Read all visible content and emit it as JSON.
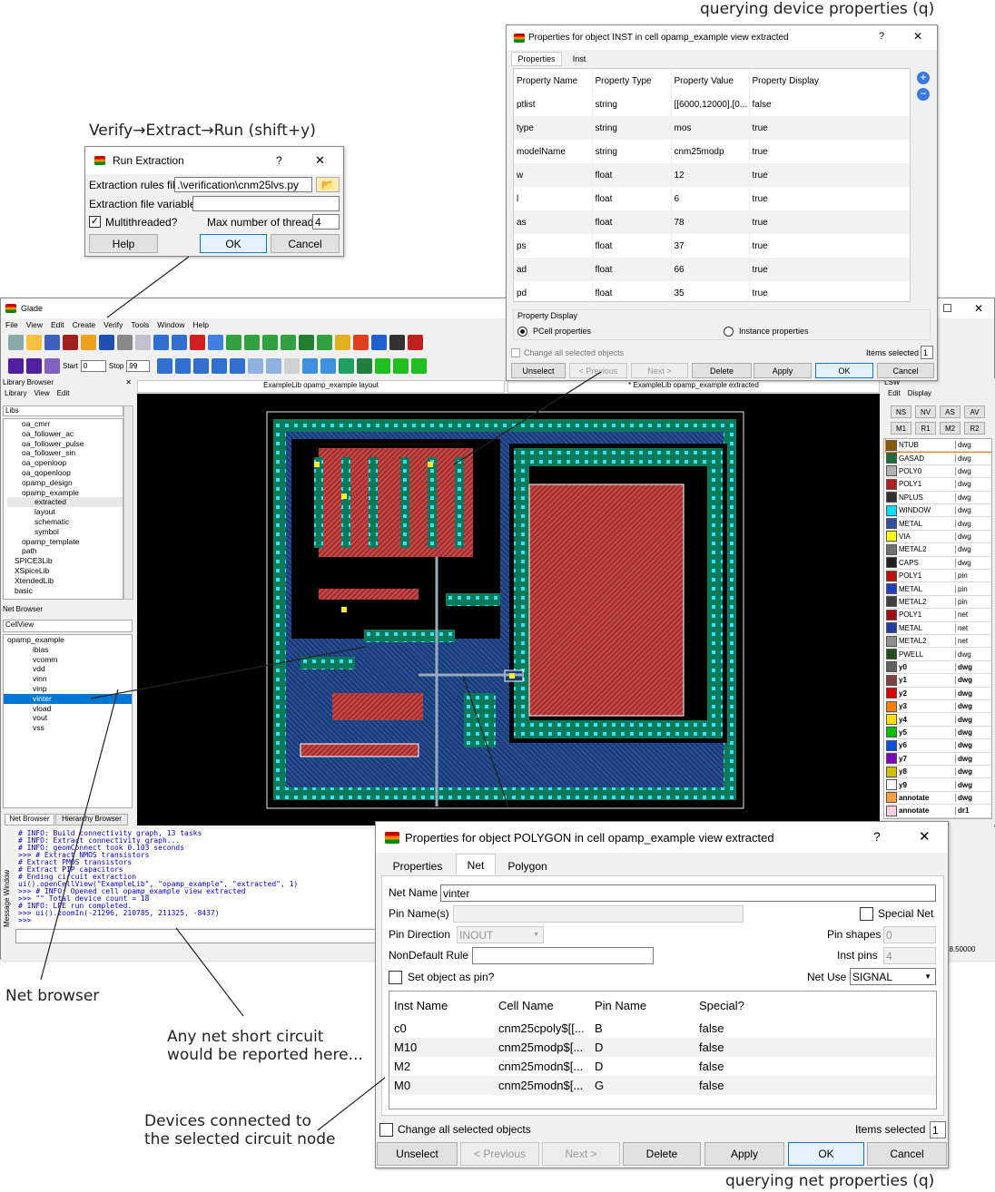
{
  "captions": {
    "verify": "Verify→Extract→Run (shift+y)",
    "query_device": "querying device properties (q)",
    "query_net": "querying net properties (q)",
    "net_browser": "Net browser",
    "short": "Any net short circuit\nwould be reported here...",
    "devices": "Devices connected to\nthe selected circuit node"
  },
  "run_extraction": {
    "title": "Run Extraction",
    "help": "?",
    "close": "✕",
    "rules_label": "Extraction rules file",
    "rules_value": ".\\verification\\cnm25lvs.py",
    "vars_label": "Extraction file variables",
    "vars_value": "",
    "multithread_label": "Multithreaded?",
    "multithread_checked": true,
    "threads_label": "Max number of threads",
    "threads_value": "4",
    "help_btn": "Help",
    "ok_btn": "OK",
    "cancel_btn": "Cancel"
  },
  "main": {
    "title": "Glade",
    "menu": [
      "File",
      "View",
      "Edit",
      "Create",
      "Verify",
      "Tools",
      "Window",
      "Help"
    ],
    "start_label": "Start",
    "start_value": "0",
    "stop_label": "Stop",
    "stop_value": "99",
    "tab_layout": "ExampleLib opamp_example layout",
    "tab_extracted": "* ExampleLib opamp_example extracted",
    "close_btn": "✕",
    "max_btn": "☐",
    "coord_readout": "68.50000"
  },
  "library_browser": {
    "title": "Library Browser",
    "menu": [
      "Library",
      "View",
      "Edit"
    ],
    "libs_label": "Libs",
    "items": [
      "oa_cmrr",
      "oa_follower_ac",
      "oa_follower_pulse",
      "oa_follower_sin",
      "oa_openloop",
      "oa_qopenloop",
      "opamp_design",
      "opamp_example",
      "extracted",
      "layout",
      "schematic",
      "symbol",
      "opamp_template",
      "path",
      "SPICE3Lib",
      "XSpiceLib",
      "XtendedLib",
      "basic"
    ]
  },
  "net_browser": {
    "title": "Net Browser",
    "cellview_label": "CellView",
    "root": "opamp_example",
    "nets": [
      "ibias",
      "vcomm",
      "vdd",
      "vinn",
      "vinp",
      "vinter",
      "vload",
      "vout",
      "vss"
    ],
    "selected": "vinter",
    "tab_net": "Net Browser",
    "tab_hier": "Hierarchy Browser"
  },
  "message_window": {
    "side_label": "Message Window",
    "lines": [
      "# INFO: Build connectivity graph, 13 tasks",
      "# INFO: Extract connectivity graph...",
      "# INFO: geomConnect took 0.103 seconds",
      ">>> # Extract NMOS transistors",
      "# Extract PMOS transistors",
      "# Extract PIP capacitors",
      "# Ending circuit extraction",
      "ui().openCellView(\"ExampleLib\", \"opamp_example\", \"extracted\", 1)",
      ">>> # INFO: Opened cell opamp_example view extracted",
      ">>> \"\" Total device count =  18",
      "# INFO: LPE run completed.",
      ">>> ui().zoomIn(-21296, 210785, 211325, -8437)",
      ">>>"
    ]
  },
  "lsw": {
    "title": "LSW",
    "menu": [
      "Edit",
      "Display"
    ],
    "buttons": [
      "NS",
      "NV",
      "AS",
      "AV",
      "M1",
      "R1",
      "M2",
      "R2"
    ],
    "layers": [
      {
        "name": "NTUB",
        "purpose": "dwg",
        "color": "#8a5a00"
      },
      {
        "name": "GASAD",
        "purpose": "dwg",
        "color": "#1a6a3a"
      },
      {
        "name": "POLY0",
        "purpose": "dwg",
        "color": "#b0b0b0"
      },
      {
        "name": "POLY1",
        "purpose": "dwg",
        "color": "#b02020"
      },
      {
        "name": "NPLUS",
        "purpose": "dwg",
        "color": "#303030"
      },
      {
        "name": "WINDOW",
        "purpose": "dwg",
        "color": "#00e0ff"
      },
      {
        "name": "METAL",
        "purpose": "dwg",
        "color": "#3050a0"
      },
      {
        "name": "VIA",
        "purpose": "dwg",
        "color": "#ffff00"
      },
      {
        "name": "METAL2",
        "purpose": "dwg",
        "color": "#707070"
      },
      {
        "name": "CAPS",
        "purpose": "dwg",
        "color": "#202020"
      },
      {
        "name": "POLY1",
        "purpose": "pin",
        "color": "#c01010"
      },
      {
        "name": "METAL",
        "purpose": "pin",
        "color": "#2040c0"
      },
      {
        "name": "METAL2",
        "purpose": "pin",
        "color": "#404040"
      },
      {
        "name": "POLY1",
        "purpose": "net",
        "color": "#a01010"
      },
      {
        "name": "METAL",
        "purpose": "net",
        "color": "#2040a0"
      },
      {
        "name": "METAL2",
        "purpose": "net",
        "color": "#909090"
      },
      {
        "name": "PWELL",
        "purpose": "dwg",
        "color": "#205020"
      },
      {
        "name": "y0",
        "purpose": "dwg",
        "color": "#606060"
      },
      {
        "name": "y1",
        "purpose": "dwg",
        "color": "#804040"
      },
      {
        "name": "y2",
        "purpose": "dwg",
        "color": "#e00000"
      },
      {
        "name": "y3",
        "purpose": "dwg",
        "color": "#ff8000"
      },
      {
        "name": "y4",
        "purpose": "dwg",
        "color": "#ffe000"
      },
      {
        "name": "y5",
        "purpose": "dwg",
        "color": "#00c000"
      },
      {
        "name": "y6",
        "purpose": "dwg",
        "color": "#0050e0"
      },
      {
        "name": "y7",
        "purpose": "dwg",
        "color": "#8000c0"
      },
      {
        "name": "y8",
        "purpose": "dwg",
        "color": "#d0c000"
      },
      {
        "name": "y9",
        "purpose": "dwg",
        "color": "#ffffff"
      },
      {
        "name": "annotate",
        "purpose": "dwg",
        "color": "#ffa040"
      },
      {
        "name": "annotate",
        "purpose": "dr1",
        "color": "#ffd0e0"
      }
    ]
  },
  "inst_props": {
    "title": "Properties for object INST in cell opamp_example view extracted",
    "help": "?",
    "close": "✕",
    "tabs": [
      "Properties",
      "Inst"
    ],
    "headers": [
      "Property Name",
      "Property Type",
      "Property Value",
      "Property Display"
    ],
    "rows": [
      [
        "ptlist",
        "string",
        "[[6000,12000],[0...",
        "false"
      ],
      [
        "type",
        "string",
        "mos",
        "true"
      ],
      [
        "modelName",
        "string",
        "cnm25modp",
        "true"
      ],
      [
        "w",
        "float",
        "12",
        "true"
      ],
      [
        "l",
        "float",
        "6",
        "true"
      ],
      [
        "as",
        "float",
        "78",
        "true"
      ],
      [
        "ps",
        "float",
        "37",
        "true"
      ],
      [
        "ad",
        "float",
        "66",
        "true"
      ],
      [
        "pd",
        "float",
        "35",
        "true"
      ]
    ],
    "display_group": "Property Display",
    "opt_pcell": "PCell properties",
    "opt_instance": "Instance properties",
    "change_all": "Change all selected objects",
    "items_label": "Items selected",
    "items_value": "1",
    "buttons": [
      "Unselect",
      "< Previous",
      "Next >",
      "Delete",
      "Apply",
      "OK",
      "Cancel"
    ]
  },
  "net_props": {
    "title": "Properties for object POLYGON in cell opamp_example view extracted",
    "help": "?",
    "close": "✕",
    "tabs": [
      "Properties",
      "Net",
      "Polygon"
    ],
    "net_name_label": "Net Name",
    "net_name": "vinter",
    "pin_names_label": "Pin Name(s)",
    "special_net": "Special Net",
    "pin_dir_label": "Pin Direction",
    "pin_dir": "INOUT",
    "pin_shapes_label": "Pin shapes",
    "pin_shapes": "0",
    "nondefault_label": "NonDefault Rule",
    "inst_pins_label": "Inst pins",
    "inst_pins": "4",
    "set_pin": "Set object as pin?",
    "net_use_label": "Net Use",
    "net_use": "SIGNAL",
    "headers": [
      "Inst Name",
      "Cell Name",
      "Pin Name",
      "Special?"
    ],
    "rows": [
      [
        "c0",
        "cnm25cpoly$[[...",
        "B",
        "false"
      ],
      [
        "M10",
        "cnm25modp$[...",
        "D",
        "false"
      ],
      [
        "M2",
        "cnm25modn$[...",
        "D",
        "false"
      ],
      [
        "M0",
        "cnm25modn$[...",
        "G",
        "false"
      ]
    ],
    "change_all": "Change all selected objects",
    "items_label": "Items selected",
    "items_value": "1",
    "buttons": [
      "Unselect",
      "< Previous",
      "Next >",
      "Delete",
      "Apply",
      "OK",
      "Cancel"
    ]
  }
}
